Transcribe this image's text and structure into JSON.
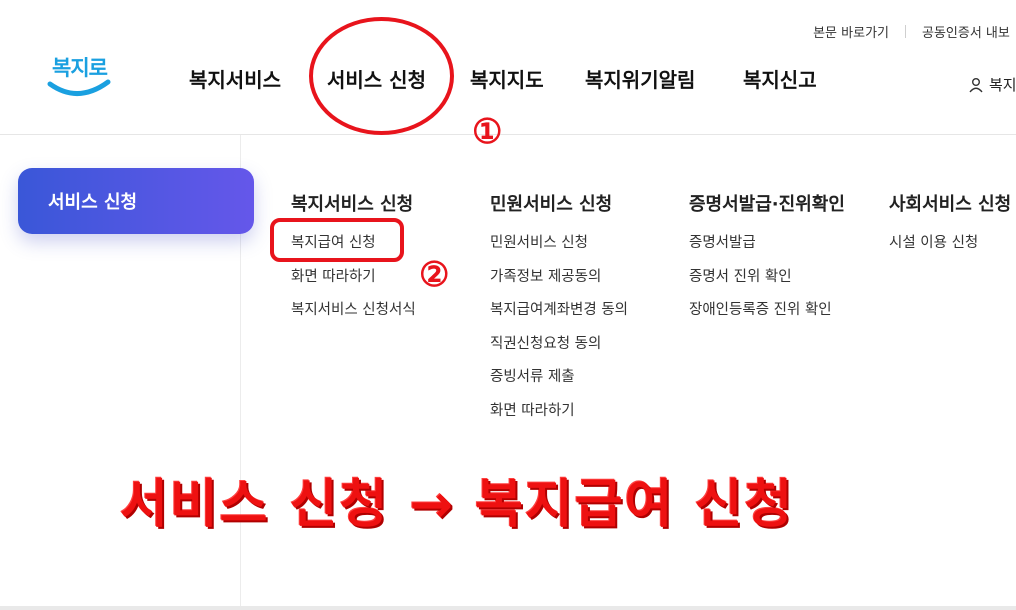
{
  "utility": {
    "skip_link": "본문 바로가기",
    "cert_export": "공동인증서 내보"
  },
  "logo": {
    "text": "복지로"
  },
  "gnb": {
    "items": [
      "복지서비스",
      "서비스 신청",
      "복지지도",
      "복지위기알림",
      "복지신고"
    ]
  },
  "user": {
    "label": "복지"
  },
  "side": {
    "active_label": "서비스 신청"
  },
  "columns": [
    {
      "title": "복지서비스 신청",
      "links": [
        "복지급여 신청",
        "화면 따라하기",
        "복지서비스 신청서식"
      ]
    },
    {
      "title": "민원서비스 신청",
      "links": [
        "민원서비스 신청",
        "가족정보 제공동의",
        "복지급여계좌변경 동의",
        "직권신청요청 동의",
        "증빙서류 제출",
        "화면 따라하기"
      ]
    },
    {
      "title": "증명서발급·진위확인",
      "links": [
        "증명서발급",
        "증명서 진위 확인",
        "장애인등록증 진위 확인"
      ]
    },
    {
      "title": "사회서비스 신청",
      "links": [
        "시설 이용 신청"
      ]
    }
  ],
  "annotations": {
    "step1": "①",
    "step2": "②",
    "banner": "서비스 신청 → 복지급여 신청",
    "color": "#e8141c"
  },
  "colors": {
    "accent_start": "#3a57d8",
    "accent_end": "#6557ea",
    "logo": "#1aa0e0"
  }
}
